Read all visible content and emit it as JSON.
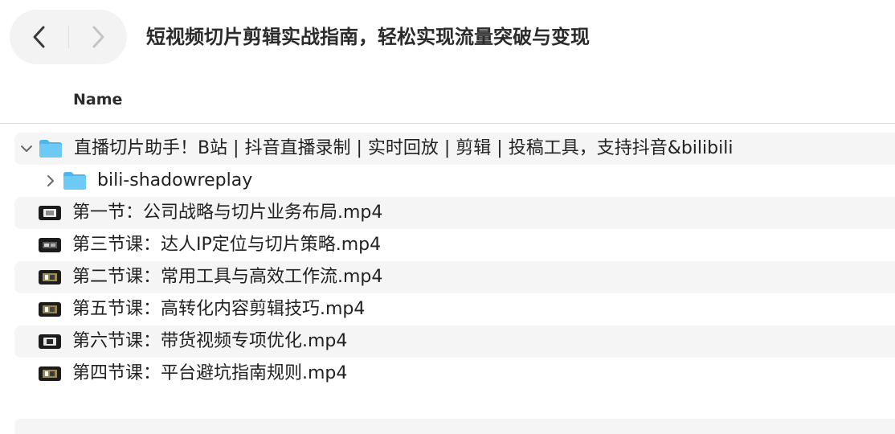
{
  "window": {
    "title": "短视频切片剪辑实战指南，轻松实现流量突破与变现"
  },
  "toolbar": {
    "back_icon": "chevron-left-icon",
    "forward_icon": "chevron-right-icon"
  },
  "header": {
    "name_column": "Name"
  },
  "files": {
    "root_folder": {
      "name": "直播切片助手！B站 | 抖音直播录制 | 实时回放 | 剪辑 | 投稿工具，支持抖音&bilibili",
      "expanded": true,
      "icon": "folder-icon"
    },
    "subfolder": {
      "name": "bili-shadowreplay",
      "expanded": false,
      "icon": "folder-icon"
    },
    "videos": [
      {
        "name": "第一节：公司战略与切片业务布局.mp4"
      },
      {
        "name": "第三节课：达人IP定位与切片策略.mp4"
      },
      {
        "name": "第二节课：常用工具与高效工作流.mp4"
      },
      {
        "name": "第五节课：高转化内容剪辑技巧.mp4"
      },
      {
        "name": "第六节课：带货视频专项优化.mp4"
      },
      {
        "name": "第四节课：平台避坑指南规则.mp4"
      }
    ]
  },
  "colors": {
    "folder_blue": "#5ec3f2",
    "row_alt": "#f5f5f5",
    "text": "#222222"
  }
}
